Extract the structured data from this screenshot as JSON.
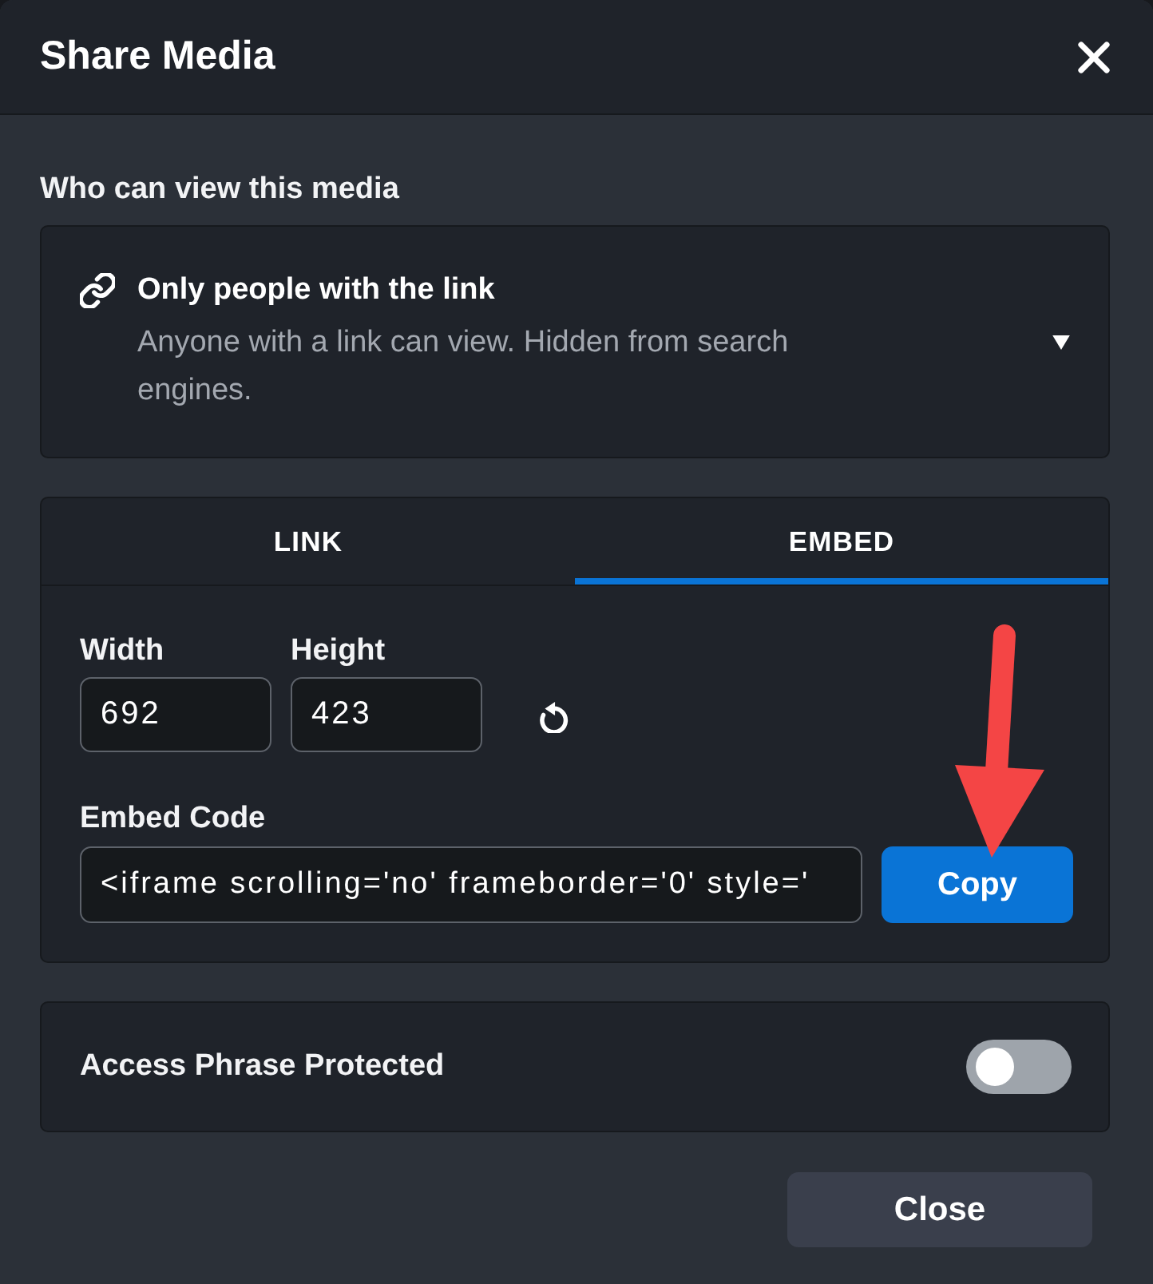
{
  "dialog": {
    "title": "Share Media"
  },
  "visibility": {
    "label": "Who can view this media",
    "option": {
      "title": "Only people with the link",
      "description": "Anyone with a link can view. Hidden from search engines."
    }
  },
  "tabs": [
    {
      "label": "LINK",
      "selected": false
    },
    {
      "label": "EMBED",
      "selected": true
    }
  ],
  "embed": {
    "width": {
      "label": "Width",
      "value": "692"
    },
    "height": {
      "label": "Height",
      "value": "423"
    },
    "code": {
      "label": "Embed Code",
      "value": "<iframe scrolling='no' frameborder='0' style='"
    },
    "copy_button": "Copy"
  },
  "access_phrase": {
    "label": "Access Phrase Protected",
    "on": false
  },
  "footer": {
    "close_button": "Close"
  }
}
